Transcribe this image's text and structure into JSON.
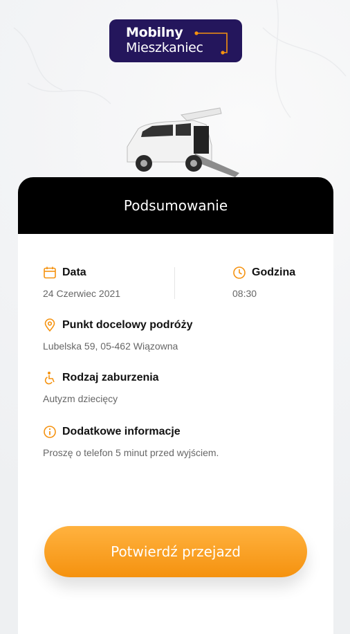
{
  "brand": {
    "line1": "Mobilny",
    "line2": "Mieszkaniec",
    "bg_color": "#24165c",
    "accent_color": "#f5920f"
  },
  "hero": {
    "icon": "wheelchair-van"
  },
  "header": {
    "title": "Podsumowanie"
  },
  "summary": {
    "date": {
      "label": "Data",
      "value": "24 Czerwiec 2021",
      "icon": "calendar-icon"
    },
    "time": {
      "label": "Godzina",
      "value": "08:30",
      "icon": "clock-icon"
    },
    "destination": {
      "label": "Punkt docelowy podróży",
      "value": "Lubelska 59, 05-462 Wiązowna",
      "icon": "location-pin-icon"
    },
    "disorder": {
      "label": "Rodzaj zaburzenia",
      "value": "Autyzm dziecięcy",
      "icon": "accessibility-icon"
    },
    "info": {
      "label": "Dodatkowe informacje",
      "value": "Proszę o telefon 5 minut przed wyjściem.",
      "icon": "info-icon"
    }
  },
  "actions": {
    "confirm_label": "Potwierdź przejazd"
  },
  "colors": {
    "accent": "#f5920f",
    "header_bg": "#000000",
    "text": "#111111",
    "muted": "#666666"
  }
}
